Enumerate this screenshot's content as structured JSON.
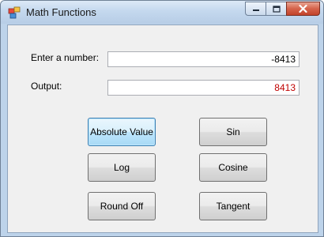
{
  "window": {
    "title": "Math Functions",
    "icon": "app-window-icon",
    "controls": {
      "minimize": "minimize-icon",
      "maximize": "maximize-icon",
      "close": "close-icon"
    }
  },
  "form": {
    "input_label": "Enter a number:",
    "input_value": "-8413",
    "output_label": "Output:",
    "output_value": "8413",
    "output_color": "#c00000"
  },
  "buttons": {
    "absolute_value": "Absolute Value",
    "log": "Log",
    "round_off": "Round Off",
    "sin": "Sin",
    "cosine": "Cosine",
    "tangent": "Tangent"
  }
}
